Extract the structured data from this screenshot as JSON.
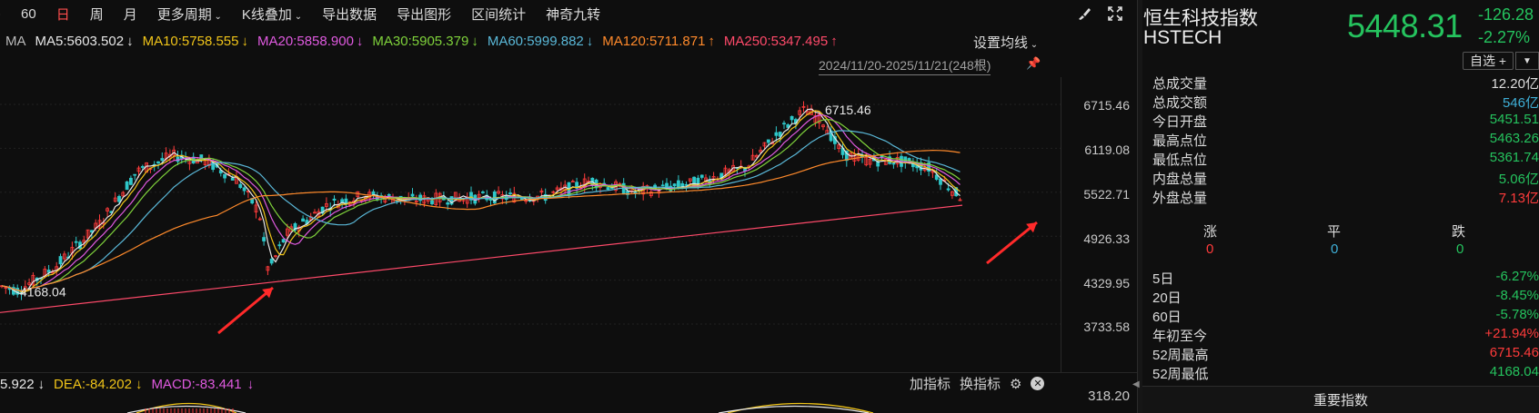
{
  "toolbar": {
    "items": [
      ")",
      "60",
      "日",
      "周",
      "月",
      "更多周期",
      "K线叠加",
      "导出数据",
      "导出图形",
      "区间统计",
      "神奇九转"
    ],
    "active_index": 2
  },
  "ma_legend": {
    "prefix": "MA",
    "items": [
      {
        "text": "MA5:5603.502",
        "arrow": "↓",
        "color": "#e8e8e8"
      },
      {
        "text": "MA10:5758.555",
        "arrow": "↓",
        "color": "#f0c419"
      },
      {
        "text": "MA20:5858.900",
        "arrow": "↓",
        "color": "#e05ae0"
      },
      {
        "text": "MA30:5905.379",
        "arrow": "↓",
        "color": "#7fd23b"
      },
      {
        "text": "MA60:5999.882",
        "arrow": "↓",
        "color": "#5ab8d8"
      },
      {
        "text": "MA120:5711.871",
        "arrow": "↑",
        "color": "#ff8a2b"
      },
      {
        "text": "MA250:5347.495",
        "arrow": "↑",
        "color": "#ff4a6a"
      }
    ],
    "settings_label": "设置均线"
  },
  "range_tag": "2024/11/20-2025/11/21(248根)",
  "y_axis": [
    "6715.46",
    "6119.08",
    "5522.71",
    "4926.33",
    "4329.95",
    "3733.58"
  ],
  "annotations": {
    "high_label": "6715.46",
    "low_label": "4168.04"
  },
  "macd": {
    "dif_text": "5.922",
    "dea_text": "DEA:-84.202",
    "macd_text": "MACD:-83.441",
    "arrow": "↓",
    "add_label": "加指标",
    "switch_label": "换指标",
    "y_label": "318.20",
    "colors": {
      "dif": "#e8e8e8",
      "dea": "#f0c419",
      "macd": "#e05ae0"
    }
  },
  "info": {
    "name": "恒生科技指数",
    "code": "HSTECH",
    "price": "5448.31",
    "change": "-126.28",
    "change_pct": "-2.27%",
    "watch_label": "自选 +",
    "stats": [
      {
        "label": "总成交量",
        "value": "12.20亿",
        "tone": "neutral"
      },
      {
        "label": "总成交额",
        "value": "546亿",
        "tone": "flat"
      },
      {
        "label": "今日开盘",
        "value": "5451.51",
        "tone": "down"
      },
      {
        "label": "最高点位",
        "value": "5463.26",
        "tone": "down"
      },
      {
        "label": "最低点位",
        "value": "5361.74",
        "tone": "down"
      },
      {
        "label": "内盘总量",
        "value": "5.06亿",
        "tone": "down"
      },
      {
        "label": "外盘总量",
        "value": "7.13亿",
        "tone": "up"
      }
    ],
    "udf": {
      "up_label": "涨",
      "flat_label": "平",
      "down_label": "跌",
      "up_value": "0",
      "flat_value": "0",
      "down_value": "0"
    },
    "perf": [
      {
        "label": "5日",
        "value": "-6.27%",
        "tone": "down"
      },
      {
        "label": "20日",
        "value": "-8.45%",
        "tone": "down"
      },
      {
        "label": "60日",
        "value": "-5.78%",
        "tone": "down"
      },
      {
        "label": "年初至今",
        "value": "+21.94%",
        "tone": "up"
      },
      {
        "label": "52周最高",
        "value": "6715.46",
        "tone": "up"
      },
      {
        "label": "52周最低",
        "value": "4168.04",
        "tone": "down"
      }
    ],
    "key_index_label": "重要指数"
  },
  "colors": {
    "up": "#ff3b3b",
    "down": "#25c35e",
    "flat": "#3fb0d8",
    "background": "#0e0e0e"
  }
}
